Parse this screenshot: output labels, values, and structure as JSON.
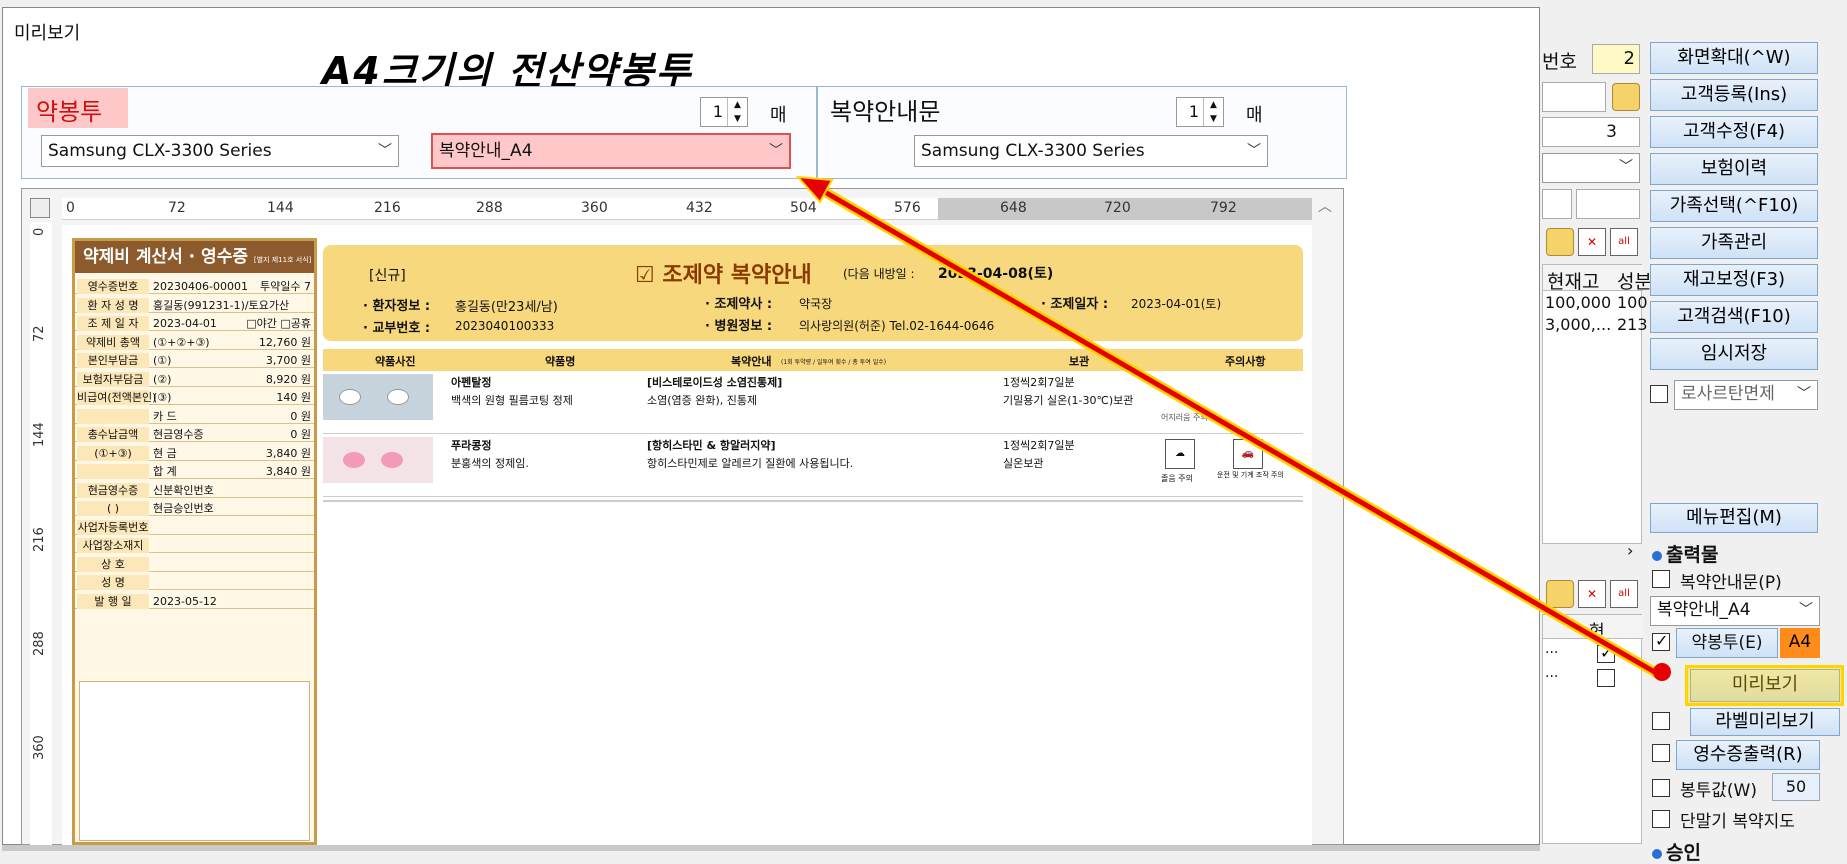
{
  "dialog": {
    "title": "미리보기",
    "banner": "A4크기의 전산약봉투"
  },
  "envelope_group": {
    "title": "약봉투",
    "printer": "Samsung CLX-3300 Series",
    "form": "복약안내_A4",
    "copies": "1",
    "copies_unit": "매"
  },
  "guide_group": {
    "title": "복약안내문",
    "printer": "Samsung CLX-3300 Series",
    "copies": "1",
    "copies_unit": "매"
  },
  "ruler": {
    "h": [
      "0",
      "72",
      "144",
      "216",
      "288",
      "360",
      "432",
      "504",
      "576",
      "648",
      "720",
      "792"
    ],
    "v": [
      "0",
      "72",
      "144",
      "216",
      "288",
      "360"
    ]
  },
  "receipt": {
    "title": "약제비 계산서 · 영수증",
    "title_sub": "[별지 제11호 서식]",
    "rows": [
      {
        "k": "영수증번호",
        "v": "20230406-00001",
        "w": "투약일수 7"
      },
      {
        "k": "환 자 성 명",
        "v": "홍길동(991231-1)/토요가산",
        "w": ""
      },
      {
        "k": "조 제 일 자",
        "v": "2023-04-01",
        "w": "□야간 □공휴"
      },
      {
        "k": "약제비 총액",
        "v": "(①+②+③)",
        "w": "12,760 원"
      },
      {
        "k": "본인부담금",
        "v": "(①)",
        "w": "3,700 원"
      },
      {
        "k": "보험자부담금",
        "v": "(②)",
        "w": "8,920 원"
      },
      {
        "k": "비급여(전액본인)",
        "v": "(③)",
        "w": "140 원"
      },
      {
        "k": "",
        "v": "카 드",
        "w": "0 원"
      },
      {
        "k": "총수납금액",
        "v": "현금영수증",
        "w": "0 원"
      },
      {
        "k": "(①+③)",
        "v": "현 금",
        "w": "3,840 원"
      },
      {
        "k": "",
        "v": "합 계",
        "w": "3,840 원"
      },
      {
        "k": "현금영수증",
        "v": "신분확인번호",
        "w": ""
      },
      {
        "k": "(        )",
        "v": "현금승인번호",
        "w": ""
      },
      {
        "k": "사업자등록번호",
        "v": "",
        "w": ""
      },
      {
        "k": "사업장소재지",
        "v": "",
        "w": ""
      },
      {
        "k": "상 호",
        "v": "",
        "w": ""
      },
      {
        "k": "성 명",
        "v": "",
        "w": ""
      },
      {
        "k": "발 행 일",
        "v": "2023-05-12",
        "w": ""
      }
    ]
  },
  "guide": {
    "tag": "[신규]",
    "title": "☑ 조제약 복약안내",
    "next_visit_label": "(다음 내방일 :",
    "next_visit": "2023-04-08(토)",
    "patient_label": "· 환자정보 :",
    "patient": "홍길동(만23세/남)",
    "pharmacist_label": "· 조제약사 :",
    "pharmacist": "약국장",
    "date_label": "· 조제일자 :",
    "date": "2023-04-01(토)",
    "exchange_label": "· 교부번호 :",
    "exchange": "2023040100333",
    "hospital_label": "· 병원정보 :",
    "hospital": "의사랑의원(허준) Tel.02-1644-0646",
    "columns": [
      "약품사진",
      "약품명",
      "복약안내",
      "(1회 투약량 / 일투여 횟수 / 총 투여 일수)",
      "보관",
      "주의사항"
    ],
    "drugs": [
      {
        "name": "아펜탈정",
        "desc": "백색의 원형 필름코팅 정제",
        "effect": "[비스테로이드성 소염진통제]",
        "effect_desc": "소염(염증 완화), 진통제",
        "dose": "1정씩2회7일분",
        "storage": "기밀용기 실온(1-30℃)보관",
        "caution": "어지러움 주의"
      },
      {
        "name": "푸라콩정",
        "desc": "분홍색의 정제임.",
        "effect": "[항히스타민 & 항알러지약]",
        "effect_desc": "항히스타민제로 알레르기 질환에 사용됩니다.",
        "dose": "1정씩2회7일분",
        "storage": "실온보관",
        "caution": "졸음 주의",
        "caution2": "운전 및 기계 조작 주의"
      }
    ]
  },
  "main": {
    "top_label": "번호",
    "top_value": "2",
    "spin_value": "3",
    "buttons": [
      "화면확대(^W)",
      "고객등록(Ins)",
      "고객수정(F4)",
      "보험이력",
      "가족선택(^F10)",
      "가족관리",
      "재고보정(F3)",
      "고객검색(F10)",
      "임시저장"
    ],
    "grid_headers": [
      "현재고",
      "성분"
    ],
    "grid_rows": [
      [
        "100,000",
        "100"
      ],
      [
        "3,000,...",
        "213"
      ]
    ],
    "losartan": "로사르탄면제",
    "menu_edit": "메뉴편집(M)",
    "output_title": "출력물",
    "guide_check": "복약안내문(P)",
    "guide_form": "복약안내_A4",
    "envelope_check": "약봉투(E)",
    "envelope_badge": "A4",
    "preview_btn": "미리보기",
    "label_preview": "라벨미리보기",
    "receipt_print": "영수증출력(R)",
    "envelope_price": "봉투값(W)",
    "envelope_price_val": "50",
    "terminal": "단말기 복약지도",
    "approval_title": "승인",
    "grid2_header": "현",
    "grid2_rows": [
      "...",
      "..."
    ]
  },
  "colors": {
    "highlight": "#ffd400",
    "arrow": "#e60000",
    "accent_badge": "#ff8c1a",
    "receipt_brown": "#8c5a2c",
    "guide_yellow": "#f8d87c"
  }
}
